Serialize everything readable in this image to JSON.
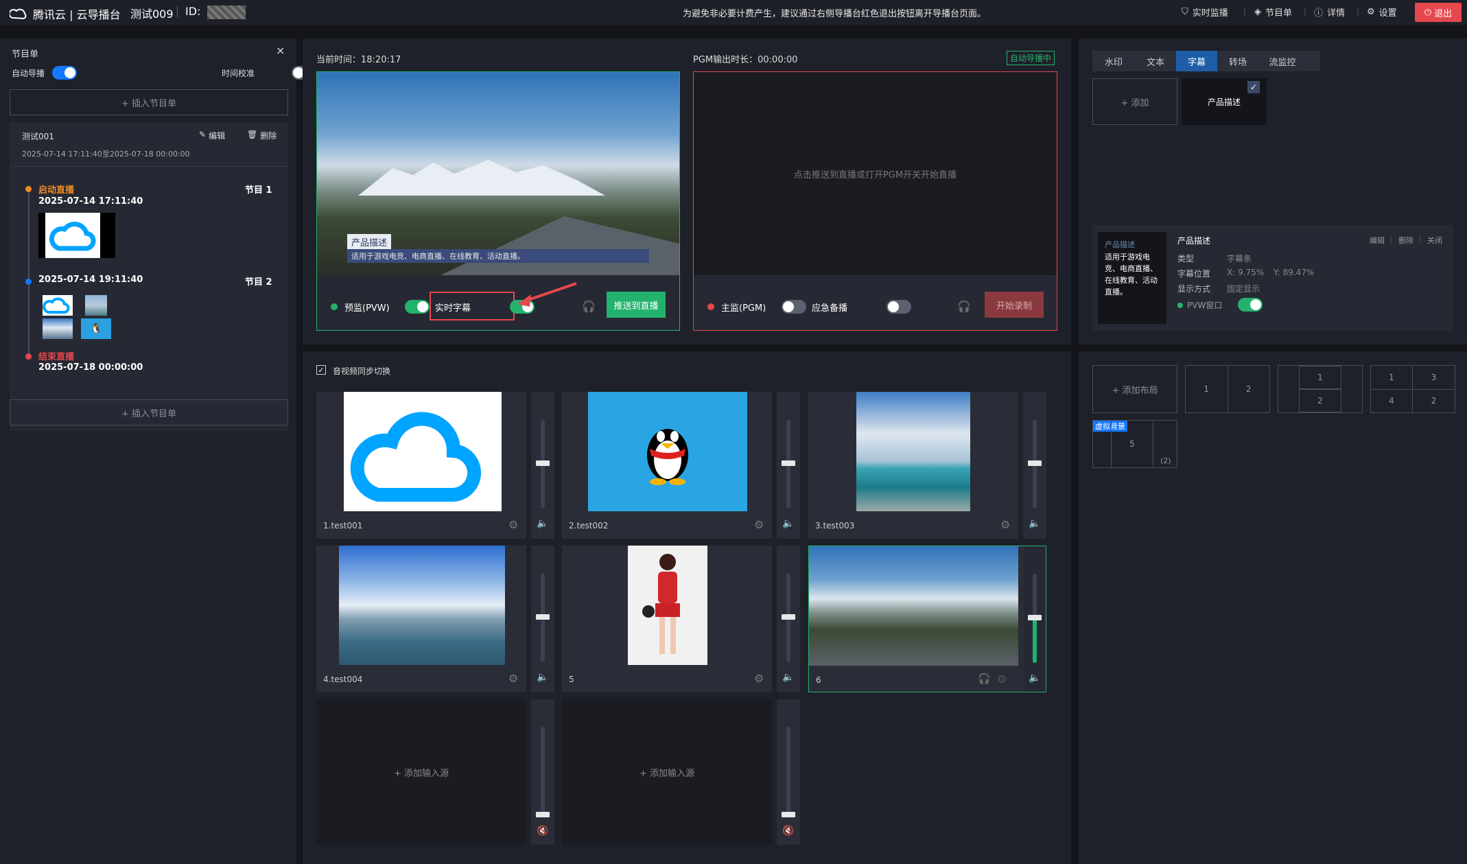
{
  "topbar": {
    "brand": "腾讯云 | 云导播台",
    "task_name": "测试009",
    "id_label": "ID:",
    "notice": "为避免非必要计费产生，建议通过右侧导播台红色退出按钮离开导播台页面。",
    "menu": [
      "实时监播",
      "节目单",
      "详情",
      "设置"
    ],
    "exit": "退出"
  },
  "sidebar": {
    "title": "节目单",
    "auto_label": "自动导播",
    "time_label": "时间校准",
    "insert_label": "+ 插入节目单",
    "card": {
      "name": "测试001",
      "edit": "编辑",
      "delete": "删除",
      "range": "2025-07-14 17:11:40至2025-07-18 00:00:00",
      "start_label": "启动直播",
      "t1": "2025-07-14 17:11:40",
      "p1": "节目 1",
      "t2": "2025-07-14 19:11:40",
      "p2": "节目 2",
      "end_label": "结束直播",
      "t3": "2025-07-18 00:00:00"
    },
    "insert_label_2": "+ 插入节目单"
  },
  "monitor": {
    "current_time_label": "当前时间：18:20:17",
    "pgm_duration_label": "PGM输出时长：00:00:00",
    "auto_badge": "自动导播中",
    "caption_title": "产品描述",
    "caption_text": "适用于游戏电竞、电商直播、在线教育、活动直播。",
    "pvw_label": "预监(PVW)",
    "realtime_subtitle": "实时字幕",
    "push_btn": "推送到直播",
    "pgm_placeholder": "点击推送到直播或打开PGM开关开始直播",
    "pgm_label": "主监(PGM)",
    "backup_label": "应急备播",
    "record_btn": "开始录制"
  },
  "right": {
    "tabs": [
      "水印",
      "文本",
      "字幕",
      "转场",
      "流监控"
    ],
    "add": "+ 添加",
    "item": "产品描述",
    "detail": {
      "thumb_title": "产品描述",
      "thumb_text": "适用于游戏电竞、电商直播、在线教育、活动直播。",
      "name": "产品描述",
      "actions": [
        "编辑",
        "删除",
        "关闭"
      ],
      "type_label": "类型",
      "type_val": "字幕条",
      "pos_label": "字幕位置",
      "pos_x": "X: 9.75%",
      "pos_y": "Y: 89.47%",
      "mode_label": "显示方式",
      "mode_val": "固定显示",
      "pvw_window": "PVW窗口"
    },
    "layout_add": "+ 添加布局",
    "virtual_bg": "虚拟背景",
    "vb_num": "5",
    "vb_count": "(2)"
  },
  "sources": {
    "sync_label": "音视频同步切换",
    "items": [
      "1.test001",
      "2.test002",
      "3.test003",
      "4.test004",
      "5",
      "6"
    ],
    "add_input": "+ 添加输入源"
  },
  "colors": {
    "accent_green": "#23b26d",
    "danger": "#e5484d",
    "blue": "#1677ff"
  }
}
